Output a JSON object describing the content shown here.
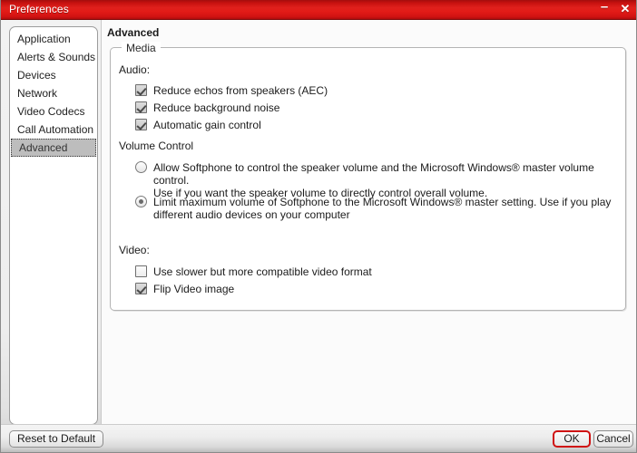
{
  "window": {
    "title": "Preferences",
    "accent_color": "#e0201c",
    "controls": {
      "minimize": "–",
      "close": "✕"
    }
  },
  "sidebar": {
    "items": [
      {
        "label": "Application",
        "selected": false
      },
      {
        "label": "Alerts & Sounds",
        "selected": false
      },
      {
        "label": "Devices",
        "selected": false
      },
      {
        "label": "Network",
        "selected": false
      },
      {
        "label": "Video Codecs",
        "selected": false
      },
      {
        "label": "Call Automation",
        "selected": false
      },
      {
        "label": "Advanced",
        "selected": true
      }
    ]
  },
  "main": {
    "page_title": "Advanced",
    "group": {
      "legend": "Media",
      "audio": {
        "label": "Audio:",
        "options": [
          {
            "label": "Reduce echos from speakers (AEC)",
            "checked": true
          },
          {
            "label": "Reduce background noise",
            "checked": true
          },
          {
            "label": "Automatic gain control",
            "checked": true
          }
        ]
      },
      "volume_control": {
        "label": "Volume Control",
        "options": [
          {
            "label": "Allow Softphone to control the speaker volume and the Microsoft Windows® master volume control.\nUse if you want the speaker volume to directly control overall volume.",
            "selected": false
          },
          {
            "label": "Limit maximum volume of Softphone to the Microsoft Windows® master setting. Use if you play\ndifferent audio devices on your computer",
            "selected": true
          }
        ]
      },
      "video": {
        "label": "Video:",
        "options": [
          {
            "label": "Use slower but more compatible video format",
            "checked": false
          },
          {
            "label": "Flip Video image",
            "checked": true
          }
        ]
      }
    }
  },
  "footer": {
    "reset_label": "Reset to Default",
    "ok_label": "OK",
    "cancel_label": "Cancel"
  }
}
